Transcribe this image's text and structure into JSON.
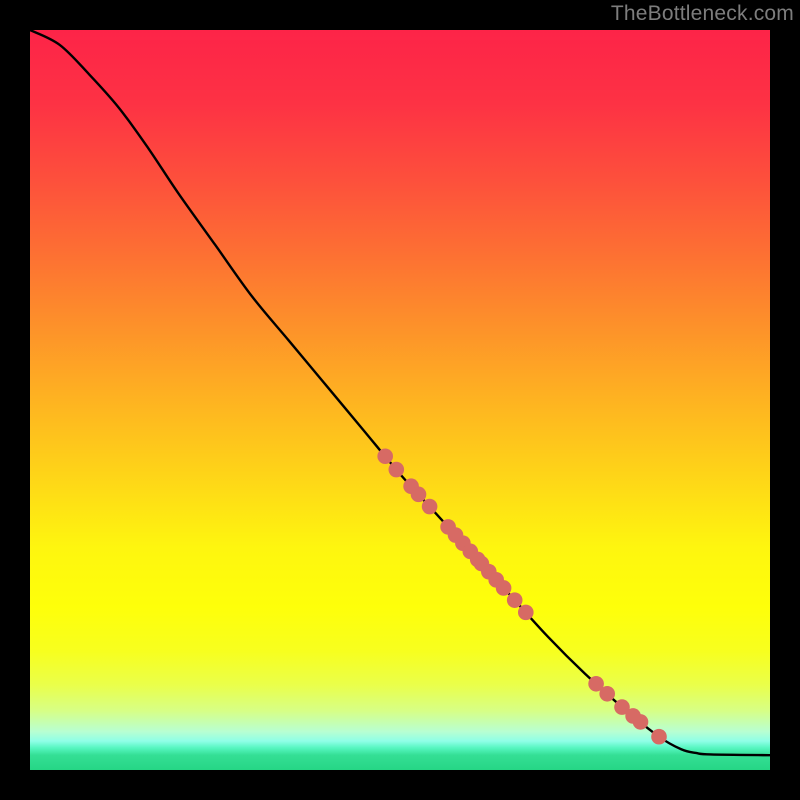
{
  "watermark": "TheBottleneck.com",
  "colors": {
    "background": "#000000",
    "gradient_stops": [
      {
        "offset": 0.0,
        "color": "#fd2448"
      },
      {
        "offset": 0.1,
        "color": "#fd3244"
      },
      {
        "offset": 0.2,
        "color": "#fd4f3c"
      },
      {
        "offset": 0.3,
        "color": "#fd6f33"
      },
      {
        "offset": 0.4,
        "color": "#fd912a"
      },
      {
        "offset": 0.5,
        "color": "#feb321"
      },
      {
        "offset": 0.6,
        "color": "#fed418"
      },
      {
        "offset": 0.7,
        "color": "#fef60f"
      },
      {
        "offset": 0.78,
        "color": "#feff0a"
      },
      {
        "offset": 0.84,
        "color": "#f7ff1f"
      },
      {
        "offset": 0.885,
        "color": "#eaff4a"
      },
      {
        "offset": 0.92,
        "color": "#d7ff86"
      },
      {
        "offset": 0.948,
        "color": "#b8ffd2"
      },
      {
        "offset": 0.961,
        "color": "#8fffe7"
      },
      {
        "offset": 0.97,
        "color": "#57f6c1"
      },
      {
        "offset": 0.98,
        "color": "#34df95"
      },
      {
        "offset": 1.0,
        "color": "#26d685"
      }
    ],
    "line": "#000000",
    "point_fill": "#d76a64",
    "point_stroke": "#9c4a47"
  },
  "chart_data": {
    "type": "line",
    "title": "",
    "xlabel": "",
    "ylabel": "",
    "xlim": [
      0,
      100
    ],
    "ylim": [
      0,
      100
    ],
    "series": [
      {
        "name": "curve",
        "x": [
          0,
          4,
          8,
          12,
          16,
          20,
          25,
          30,
          35,
          40,
          45,
          50,
          55,
          60,
          65,
          70,
          75,
          80,
          85,
          88,
          90,
          92,
          100
        ],
        "y": [
          100,
          98,
          94,
          89.5,
          84,
          78,
          71,
          64,
          58,
          52,
          46,
          40,
          34.5,
          29,
          23.5,
          18,
          13,
          8.5,
          4.5,
          2.8,
          2.3,
          2.1,
          2.0
        ]
      }
    ],
    "points_on_curve_x": [
      48,
      49.5,
      51.5,
      52.5,
      54,
      56.5,
      57.5,
      58.5,
      59.5,
      60.5,
      61,
      62,
      63,
      64,
      65.5,
      67,
      76.5,
      78,
      80,
      81.5,
      82.5,
      85
    ],
    "point_radius": 7.8
  }
}
